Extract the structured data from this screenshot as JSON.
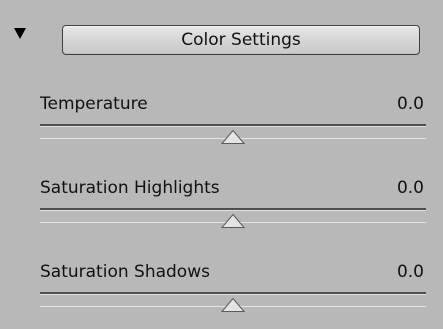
{
  "panel": {
    "button_label": "Color Settings",
    "colors": {
      "background": "#b8b8b8",
      "track": "#4e4e4e",
      "thumb": "#e4e4e4"
    },
    "sliders": [
      {
        "label": "Temperature",
        "value": "0.0",
        "position": 0.5
      },
      {
        "label": "Saturation Highlights",
        "value": "0.0",
        "position": 0.5
      },
      {
        "label": "Saturation Shadows",
        "value": "0.0",
        "position": 0.5
      }
    ]
  }
}
